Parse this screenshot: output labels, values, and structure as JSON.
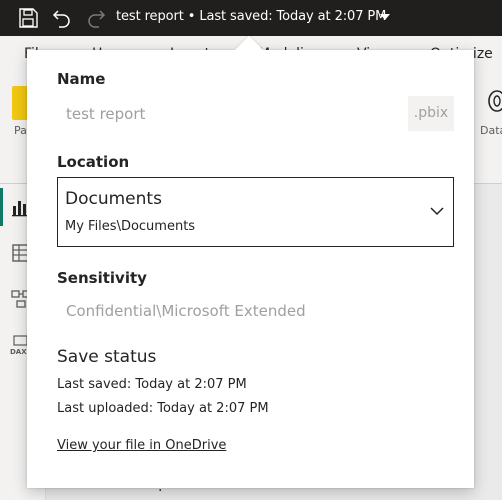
{
  "titlebar": {
    "title": "test report • Last saved: Today at 2:07 PM",
    "save_icon": "save-icon",
    "undo_icon": "undo-icon",
    "redo_icon": "redo-icon",
    "caret_icon": "caret-down-icon"
  },
  "ribbon": {
    "menu_items": [
      "File",
      "Home",
      "Insert",
      "Modeling",
      "View",
      "Optimize"
    ],
    "left_button_label": "Paste",
    "right_button_label": "Data"
  },
  "flyout": {
    "name_label": "Name",
    "name_value": "test report",
    "extension": ".pbix",
    "location_label": "Location",
    "location_main": "Documents",
    "location_path": "My Files\\Documents",
    "sensitivity_label": "Sensitivity",
    "sensitivity_value": "Confidential\\Microsoft Extended",
    "save_status_title": "Save status",
    "last_saved": "Last saved: Today at 2:07 PM",
    "last_uploaded": "Last uploaded: Today at 2:07 PM",
    "onedrive_link": "View your file in OneDrive"
  },
  "leftnav": {
    "dax_label": "DAX"
  },
  "colors": {
    "titlebar_bg": "#201f1e",
    "accent_green": "#117865",
    "placeholder_gray": "#a19f9d"
  }
}
